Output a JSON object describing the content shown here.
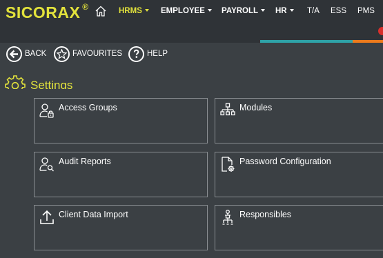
{
  "brand": {
    "name": "SICORAX",
    "mark": "®"
  },
  "nav": {
    "items": [
      {
        "label": "HRMS",
        "dropdown": true
      },
      {
        "label": "EMPLOYEE",
        "dropdown": true
      },
      {
        "label": "PAYROLL",
        "dropdown": true
      },
      {
        "label": "HR",
        "dropdown": true
      },
      {
        "label": "T/A",
        "dropdown": false
      },
      {
        "label": "ESS",
        "dropdown": false
      },
      {
        "label": "PMS",
        "dropdown": false
      }
    ],
    "active": "HRMS"
  },
  "toolbar": {
    "back": "BACK",
    "favourites": "FAVOURITES",
    "help": "HELP"
  },
  "page": {
    "title": "Settings"
  },
  "tiles": [
    {
      "label": "Access Groups",
      "icon": "user-lock-icon"
    },
    {
      "label": "Modules",
      "icon": "sitemap-icon"
    },
    {
      "label": "Audit Reports",
      "icon": "user-search-icon"
    },
    {
      "label": "Password Configuration",
      "icon": "file-gear-icon"
    },
    {
      "label": "Client Data Import",
      "icon": "upload-icon"
    },
    {
      "label": "Responsibles",
      "icon": "person-hierarchy-icon"
    }
  ],
  "colors": {
    "accent": "#e2e23c",
    "topbar": "#2f3337",
    "background": "#3b4044",
    "teal": "#2ea3a8",
    "orange": "#ec7a1c"
  }
}
